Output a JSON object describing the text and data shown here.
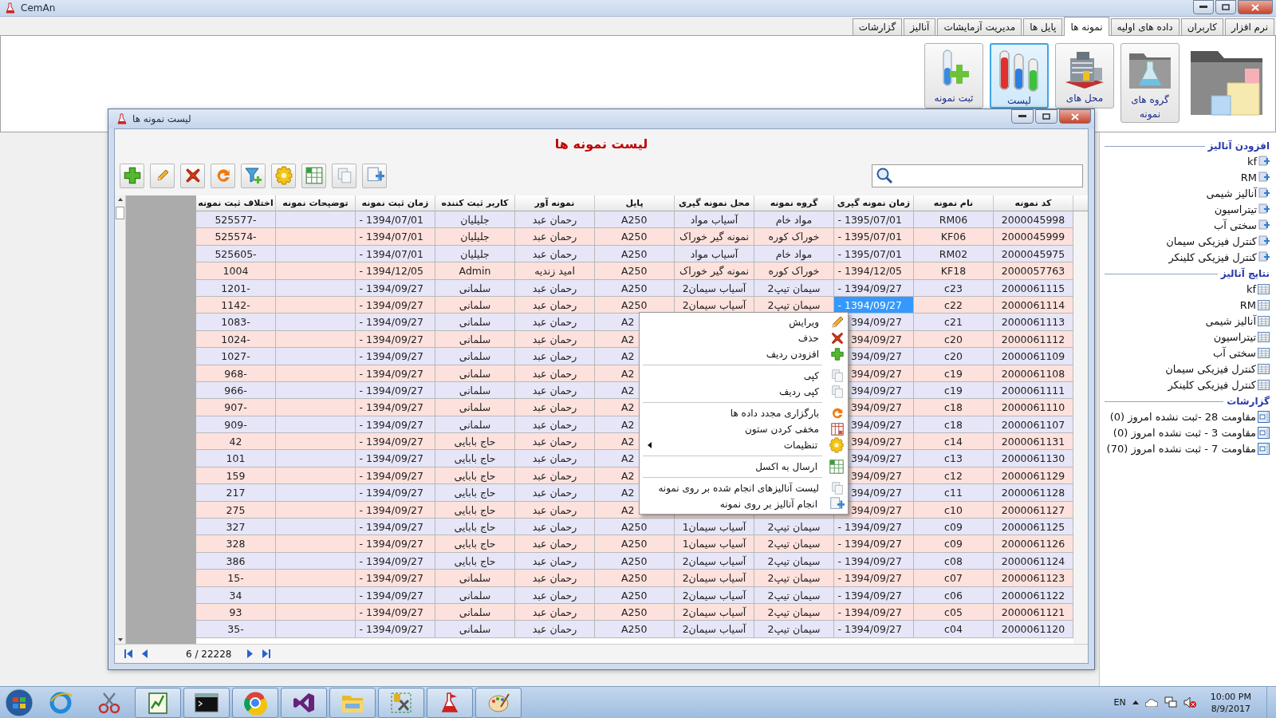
{
  "app": {
    "title": "CemAn"
  },
  "tabs": [
    {
      "label": "نرم افزار",
      "selected": false
    },
    {
      "label": "کاربران",
      "selected": false
    },
    {
      "label": "داده های اولیه",
      "selected": false
    },
    {
      "label": "نمونه ها",
      "selected": true
    },
    {
      "label": "پایل ها",
      "selected": false
    },
    {
      "label": "مدیریت آزمایشات",
      "selected": false
    },
    {
      "label": "آنالیز",
      "selected": false
    },
    {
      "label": "گزارشات",
      "selected": false
    }
  ],
  "ribbon": [
    {
      "kind": "folder"
    },
    {
      "kind": "groups",
      "lines": [
        "گروه های",
        "نمونه"
      ],
      "selected": false
    },
    {
      "kind": "places",
      "lines": [
        "محل های"
      ],
      "selected": false
    },
    {
      "kind": "list",
      "lines": [
        "لیست"
      ],
      "selected": true
    },
    {
      "kind": "add",
      "lines": [
        "ثبت نمونه"
      ],
      "selected": false
    }
  ],
  "window": {
    "title": "لیست نمونه ها",
    "heading": "لیست نمونه ها"
  },
  "table": {
    "columns": [
      "کد نمونه",
      "نام نمونه",
      "زمان نمونه گیری",
      "گروه نمونه",
      "محل نمونه گیری",
      "پایل",
      "نمونه آور",
      "کاربر ثبت کننده",
      "زمان ثبت نمونه",
      "توضیحات نمونه",
      "اختلاف ثبت نمونه"
    ],
    "rows": [
      {
        "selected": false,
        "cells": [
          "2000045998",
          "RM06",
          "- 1395/07/01",
          "مواد خام",
          "آسیاب مواد",
          "A250",
          "رحمان  عبد",
          "جلیلیان",
          "- 1394/07/01",
          null,
          "525577-"
        ]
      },
      {
        "selected": false,
        "cells": [
          "2000045999",
          "KF06",
          "- 1395/07/01",
          "خوراک کوره",
          "نمونه گیر خوراک",
          "A250",
          "رحمان  عبد",
          "جلیلیان",
          "- 1394/07/01",
          null,
          "525574-"
        ]
      },
      {
        "selected": false,
        "cells": [
          "2000045975",
          "RM02",
          "- 1395/07/01",
          "مواد خام",
          "آسیاب مواد",
          "A250",
          "رحمان  عبد",
          "جلیلیان",
          "- 1394/07/01",
          null,
          "525605-"
        ]
      },
      {
        "selected": false,
        "cells": [
          "2000057763",
          "KF18",
          "- 1394/12/05",
          "خوراک کوره",
          "نمونه گیر خوراک",
          "A250",
          "امید  زندیه",
          "Admin",
          "- 1394/12/05",
          null,
          "1004"
        ]
      },
      {
        "selected": false,
        "cells": [
          "2000061115",
          "c23",
          "- 1394/09/27",
          "سیمان تیپ2",
          "آسیاب سیمان2",
          "A250",
          "رحمان  عبد",
          "سلمانی",
          "- 1394/09/27",
          null,
          "1201-"
        ]
      },
      {
        "selected": true,
        "cells": [
          "2000061114",
          "c22",
          "- 1394/09/27",
          "سیمان تیپ2",
          "آسیاب سیمان2",
          "A250",
          "رحمان  عبد",
          "سلمانی",
          "- 1394/09/27",
          null,
          "1142-"
        ]
      },
      {
        "selected": false,
        "cells": [
          "2000061113",
          "c21",
          "394/09/27",
          null,
          null,
          "A2",
          "رحمان  عبد",
          "سلمانی",
          "- 1394/09/27",
          null,
          "1083-"
        ]
      },
      {
        "selected": false,
        "cells": [
          "2000061112",
          "c20",
          "394/09/27",
          null,
          null,
          "A2",
          "رحمان  عبد",
          "سلمانی",
          "- 1394/09/27",
          null,
          "1024-"
        ]
      },
      {
        "selected": false,
        "cells": [
          "2000061109",
          "c20",
          "394/09/27",
          null,
          null,
          "A2",
          "رحمان  عبد",
          "سلمانی",
          "- 1394/09/27",
          null,
          "1027-"
        ]
      },
      {
        "selected": false,
        "cells": [
          "2000061108",
          "c19",
          "394/09/27",
          null,
          null,
          "A2",
          "رحمان  عبد",
          "سلمانی",
          "- 1394/09/27",
          null,
          "968-"
        ]
      },
      {
        "selected": false,
        "cells": [
          "2000061111",
          "c19",
          "394/09/27",
          null,
          null,
          "A2",
          "رحمان  عبد",
          "سلمانی",
          "- 1394/09/27",
          null,
          "966-"
        ]
      },
      {
        "selected": false,
        "cells": [
          "2000061110",
          "c18",
          "394/09/27",
          null,
          null,
          "A2",
          "رحمان  عبد",
          "سلمانی",
          "- 1394/09/27",
          null,
          "907-"
        ]
      },
      {
        "selected": false,
        "cells": [
          "2000061107",
          "c18",
          "394/09/27",
          null,
          null,
          "A2",
          "رحمان  عبد",
          "سلمانی",
          "- 1394/09/27",
          null,
          "909-"
        ]
      },
      {
        "selected": false,
        "cells": [
          "2000061131",
          "c14",
          "394/09/27",
          null,
          null,
          "A2",
          "رحمان  عبد",
          "حاج بابایی",
          "- 1394/09/27",
          null,
          "42"
        ]
      },
      {
        "selected": false,
        "cells": [
          "2000061130",
          "c13",
          "394/09/27",
          null,
          null,
          "A2",
          "رحمان  عبد",
          "حاج بابایی",
          "- 1394/09/27",
          null,
          "101"
        ]
      },
      {
        "selected": false,
        "cells": [
          "2000061129",
          "c12",
          "394/09/27",
          null,
          null,
          "A2",
          "رحمان  عبد",
          "حاج بابایی",
          "- 1394/09/27",
          null,
          "159"
        ]
      },
      {
        "selected": false,
        "cells": [
          "2000061128",
          "c11",
          "394/09/27",
          null,
          null,
          "A2",
          "رحمان  عبد",
          "حاج بابایی",
          "- 1394/09/27",
          null,
          "217"
        ]
      },
      {
        "selected": false,
        "cells": [
          "2000061127",
          "c10",
          "394/09/27",
          null,
          null,
          "A2",
          "رحمان  عبد",
          "حاج بابایی",
          "- 1394/09/27",
          null,
          "275"
        ]
      },
      {
        "selected": false,
        "cells": [
          "2000061125",
          "c09",
          "- 1394/09/27",
          "سیمان تیپ2",
          "آسیاب سیمان1",
          "A250",
          "رحمان  عبد",
          "حاج بابایی",
          "- 1394/09/27",
          null,
          "327"
        ]
      },
      {
        "selected": false,
        "cells": [
          "2000061126",
          "c09",
          "- 1394/09/27",
          "سیمان تیپ2",
          "آسیاب سیمان1",
          "A250",
          "رحمان  عبد",
          "حاج بابایی",
          "- 1394/09/27",
          null,
          "328"
        ]
      },
      {
        "selected": false,
        "cells": [
          "2000061124",
          "c08",
          "- 1394/09/27",
          "سیمان تیپ2",
          "آسیاب سیمان2",
          "A250",
          "رحمان  عبد",
          "حاج بابایی",
          "- 1394/09/27",
          null,
          "386"
        ]
      },
      {
        "selected": false,
        "cells": [
          "2000061123",
          "c07",
          "- 1394/09/27",
          "سیمان تیپ2",
          "آسیاب سیمان2",
          "A250",
          "رحمان  عبد",
          "سلمانی",
          "- 1394/09/27",
          null,
          "15-"
        ]
      },
      {
        "selected": false,
        "cells": [
          "2000061122",
          "c06",
          "- 1394/09/27",
          "سیمان تیپ2",
          "آسیاب سیمان2",
          "A250",
          "رحمان  عبد",
          "سلمانی",
          "- 1394/09/27",
          null,
          "34"
        ]
      },
      {
        "selected": false,
        "cells": [
          "2000061121",
          "c05",
          "- 1394/09/27",
          "سیمان تیپ2",
          "آسیاب سیمان2",
          "A250",
          "رحمان  عبد",
          "سلمانی",
          "- 1394/09/27",
          null,
          "93"
        ]
      },
      {
        "selected": false,
        "cells": [
          "2000061120",
          "c04",
          "- 1394/09/27",
          "سیمان تیپ2",
          "آسیاب سیمان2",
          "A250",
          "رحمان  عبد",
          "سلمانی",
          "- 1394/09/27",
          null,
          "35-"
        ]
      }
    ]
  },
  "context_menu": {
    "items": [
      {
        "kind": "item",
        "label": "ویرایش"
      },
      {
        "kind": "item",
        "label": "حذف"
      },
      {
        "kind": "item",
        "label": "افزودن ردیف"
      },
      {
        "kind": "separator"
      },
      {
        "kind": "item",
        "label": "کپی"
      },
      {
        "kind": "item",
        "label": "کپی ردیف"
      },
      {
        "kind": "separator"
      },
      {
        "kind": "item",
        "label": "بارگزاری مجدد داده ها"
      },
      {
        "kind": "item",
        "label": "مخفی کردن ستون"
      },
      {
        "kind": "item",
        "label": "تنظیمات",
        "submenu": true
      },
      {
        "kind": "separator"
      },
      {
        "kind": "item",
        "label": "ارسال به اکسل"
      },
      {
        "kind": "separator"
      },
      {
        "kind": "item",
        "label": "لیست آنالیزهای انجام شده بر روی نمونه"
      },
      {
        "kind": "item",
        "label": "انجام آنالیز بر روی نمونه"
      }
    ]
  },
  "pager": {
    "text": "6 / 22228"
  },
  "sidebar": {
    "sections": [
      {
        "kind": "add",
        "title": "افزودن آنالیز",
        "items": [
          "kf",
          "RM",
          "آنالیز شیمی",
          "تیتراسیون",
          "سختی آب",
          "کنترل فیزیکی سیمان",
          "کنترل فیزیکی کلینکر"
        ]
      },
      {
        "kind": "results",
        "title": "نتایج آنالیز",
        "items": [
          "kf",
          "RM",
          "آنالیز شیمی",
          "تیتراسیون",
          "سختی آب",
          "کنترل فیزیکی سیمان",
          "کنترل فیزیکی کلینکر"
        ]
      },
      {
        "kind": "report",
        "title": "گزارشات",
        "items": [
          "مقاومت 28 -ثبت نشده امروز (0)",
          "مقاومت 3 - ثبت نشده امروز (0)",
          "مقاومت 7 - ثبت نشده امروز (70)"
        ]
      }
    ]
  },
  "taskbar": {
    "apps": [
      {
        "kind": "globe",
        "running": false
      },
      {
        "kind": "scissors",
        "running": false
      },
      {
        "kind": "notepad",
        "running": true
      },
      {
        "kind": "console",
        "running": true
      },
      {
        "kind": "ring",
        "running": true
      },
      {
        "kind": "infinity",
        "running": true
      },
      {
        "kind": "folder",
        "running": true
      },
      {
        "kind": "tool",
        "running": true
      },
      {
        "kind": "flask",
        "running": true
      },
      {
        "kind": "palette",
        "running": true
      }
    ],
    "language": "EN",
    "time": "10:00 PM",
    "date": "8/9/2017"
  }
}
